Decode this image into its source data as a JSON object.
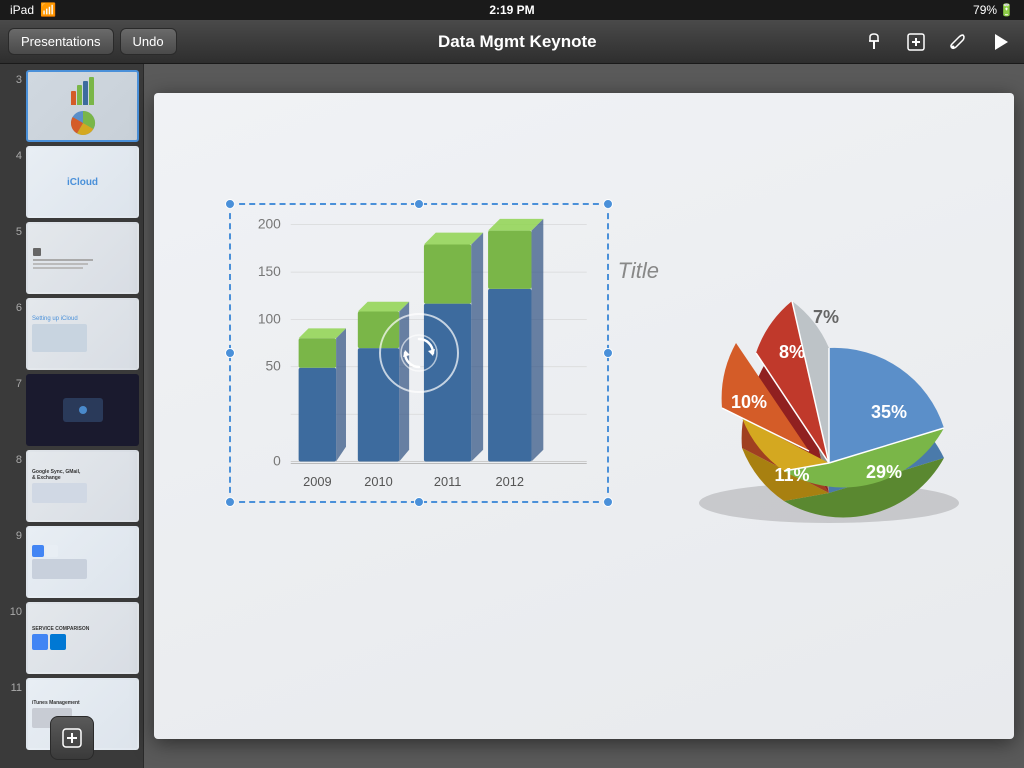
{
  "status": {
    "device": "iPad",
    "time": "2:19 PM",
    "battery": "79%",
    "wifi": "wifi"
  },
  "toolbar": {
    "presentations_label": "Presentations",
    "undo_label": "Undo",
    "title": "Data Mgmt Keynote",
    "pin_icon": "📌",
    "add_icon": "+",
    "wrench_icon": "🔧",
    "play_icon": "▶"
  },
  "slides": [
    {
      "number": "3",
      "type": "chart",
      "active": true
    },
    {
      "number": "4",
      "type": "icloud",
      "active": false
    },
    {
      "number": "5",
      "type": "text",
      "active": false
    },
    {
      "number": "6",
      "type": "setup",
      "active": false
    },
    {
      "number": "7",
      "type": "dark",
      "active": false
    },
    {
      "number": "8",
      "type": "sync",
      "active": false
    },
    {
      "number": "9",
      "type": "gmail",
      "active": false
    },
    {
      "number": "10",
      "type": "comparison",
      "active": false
    },
    {
      "number": "11",
      "type": "itunes",
      "active": false
    }
  ],
  "canvas": {
    "slide_title": "Title",
    "bar_chart": {
      "years": [
        "2009",
        "2010",
        "2011",
        "2012"
      ],
      "y_labels": [
        "200",
        "150",
        "100",
        "50",
        "0"
      ]
    },
    "pie_chart": {
      "segments": [
        {
          "label": "35%",
          "color": "#5b8fc9",
          "value": 35
        },
        {
          "label": "29%",
          "color": "#7ab648",
          "value": 29
        },
        {
          "label": "11%",
          "color": "#d4a820",
          "value": 11
        },
        {
          "label": "10%",
          "color": "#d45c28",
          "value": 10
        },
        {
          "label": "8%",
          "color": "#c0392b",
          "value": 8
        },
        {
          "label": "7%",
          "color": "#bdc3c7",
          "value": 7
        }
      ]
    }
  },
  "add_slide_label": "+",
  "colors": {
    "accent_blue": "#4a90d9",
    "bar_green": "#7ab648",
    "bar_blue": "#3d6b9e",
    "pie_blue": "#5b8fc9",
    "pie_green": "#7ab648",
    "toolbar_bg": "#2e2e2e"
  }
}
